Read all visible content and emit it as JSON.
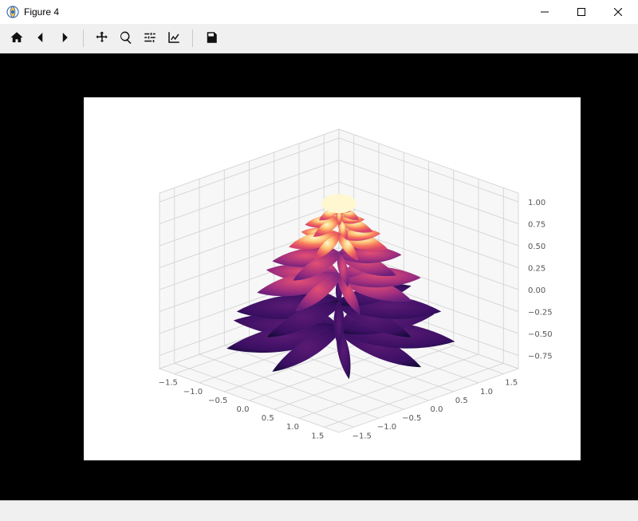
{
  "window": {
    "title": "Figure 4"
  },
  "toolbar": {
    "home": "Home",
    "back": "Back",
    "forward": "Forward",
    "pan": "Pan",
    "zoom": "Zoom",
    "subplots": "Configure subplots",
    "edit": "Edit parameters",
    "save": "Save"
  },
  "chart_data": {
    "type": "surface3d",
    "description": "Parametric 3D rose / flower surface colored by height (magma-like colormap: dark purple → red → orange → pale yellow).",
    "x_ticks": [
      -1.5,
      -1.0,
      -0.5,
      0.0,
      0.5,
      1.0,
      1.5
    ],
    "y_ticks": [
      -1.5,
      -1.0,
      -0.5,
      0.0,
      0.5,
      1.0,
      1.5
    ],
    "z_ticks": [
      -0.75,
      -0.5,
      -0.25,
      0.0,
      0.25,
      0.5,
      0.75,
      1.0
    ],
    "xlim": [
      -1.8,
      1.8
    ],
    "ylim": [
      -1.8,
      1.8
    ],
    "zlim": [
      -0.9,
      1.1
    ],
    "colormap": "magma",
    "grid": true,
    "xlabel": "",
    "ylabel": "",
    "zlabel": "",
    "title": ""
  }
}
